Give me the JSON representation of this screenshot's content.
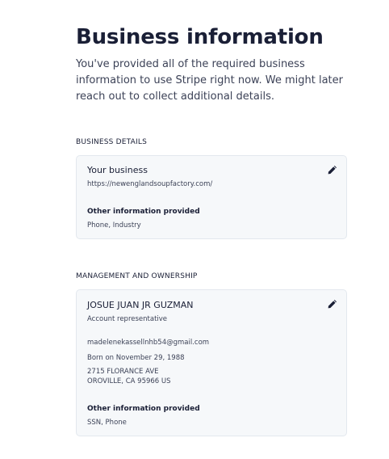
{
  "header": {
    "title": "Business information",
    "subtitle": "You've provided all of the required business information to use Stripe right now. We might later reach out to collect additional details."
  },
  "business_details": {
    "section_label": "BUSINESS DETAILS",
    "card_title": "Your business",
    "website": "https://newenglandsoupfactory.com/",
    "other_info_label": "Other information provided",
    "other_info_value": "Phone, Industry",
    "edit_icon": "pencil-icon"
  },
  "management": {
    "section_label": "MANAGEMENT AND OWNERSHIP",
    "person_name": "JOSUE JUAN JR GUZMAN",
    "role": "Account representative",
    "email": "madelenekassellnhb54@gmail.com",
    "born": "Born on November 29, 1988",
    "address_line1": "2715 FLORANCE AVE",
    "address_line2": "OROVILLE, CA 95966 US",
    "other_info_label": "Other information provided",
    "other_info_value": "SSN, Phone",
    "edit_icon": "pencil-icon"
  },
  "colors": {
    "card_background": "#f6f8fa",
    "card_border": "#e3e8ee",
    "text_primary": "#1a1f36",
    "text_secondary": "#3c4257"
  }
}
